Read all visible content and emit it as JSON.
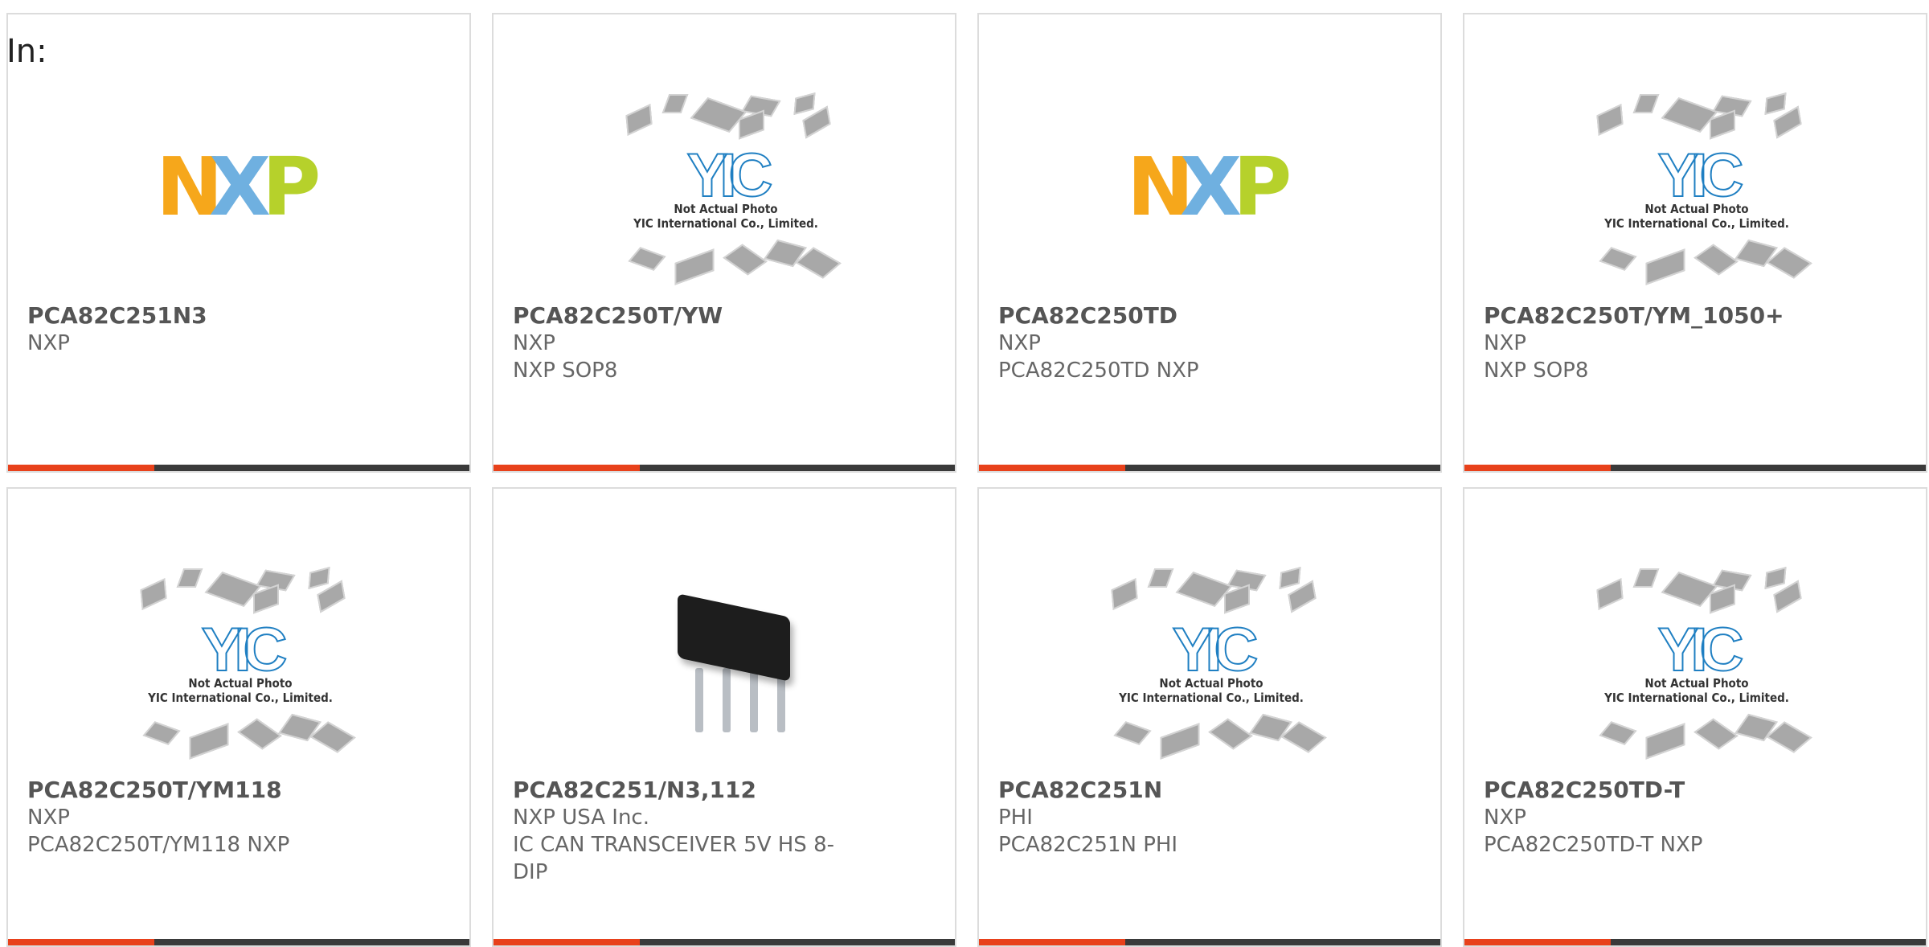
{
  "header": {
    "label": "In:"
  },
  "placeholder": {
    "line1": "Not Actual Photo",
    "line2": "YIC International Co., Limited.",
    "logo_text": "YIC"
  },
  "brand": {
    "nxp_letters": [
      "N",
      "X",
      "P"
    ],
    "nxp_colors": [
      "#f6a71b",
      "#6fb0e0",
      "#b6d12b"
    ]
  },
  "colors": {
    "accent": "#e8411b",
    "bar": "#3a3a3a",
    "border": "#dcdcdc"
  },
  "products": [
    {
      "part": "PCA82C251N3",
      "brand": "NXP",
      "desc": "",
      "image": "nxp-logo"
    },
    {
      "part": "PCA82C250T/YW",
      "brand": "NXP",
      "desc": "NXP SOP8",
      "image": "placeholder"
    },
    {
      "part": "PCA82C250TD",
      "brand": "NXP",
      "desc": "PCA82C250TD NXP",
      "image": "nxp-logo"
    },
    {
      "part": "PCA82C250T/YM_1050+",
      "brand": "NXP",
      "desc": "NXP SOP8",
      "image": "placeholder"
    },
    {
      "part": "PCA82C250T/YM118",
      "brand": "NXP",
      "desc": "PCA82C250T/YM118 NXP",
      "image": "placeholder"
    },
    {
      "part": "PCA82C251/N3,112",
      "brand": "NXP USA Inc.",
      "desc": "IC CAN TRANSCEIVER 5V HS 8-DIP",
      "image": "dip-chip"
    },
    {
      "part": "PCA82C251N",
      "brand": "PHI",
      "desc": "PCA82C251N PHI",
      "image": "placeholder"
    },
    {
      "part": "PCA82C250TD-T",
      "brand": "NXP",
      "desc": "PCA82C250TD-T NXP",
      "image": "placeholder"
    }
  ]
}
